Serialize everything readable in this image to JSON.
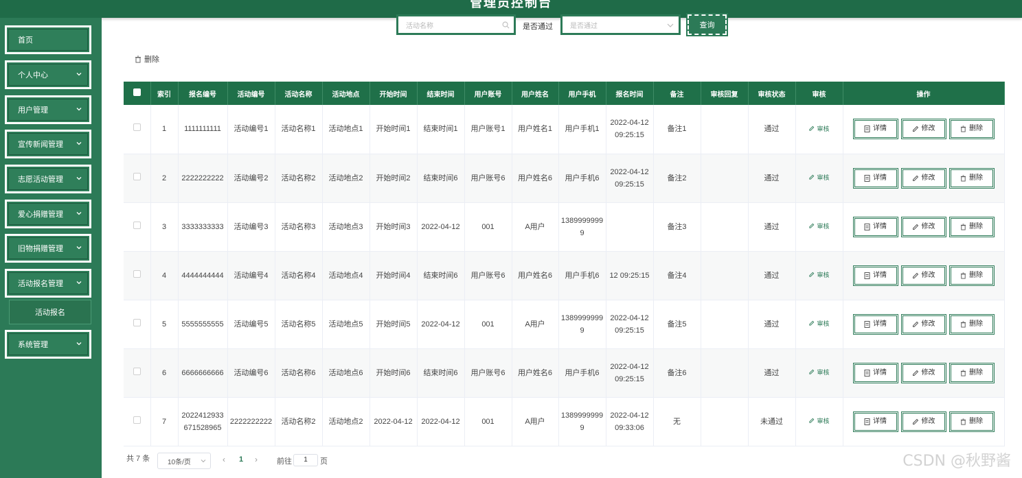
{
  "header": {
    "title": "管理员控制台"
  },
  "sidebar": {
    "items": [
      {
        "label": "首页",
        "has_chevron": false
      },
      {
        "label": "个人中心",
        "has_chevron": true
      },
      {
        "label": "用户管理",
        "has_chevron": true
      },
      {
        "label": "宣传新闻管理",
        "has_chevron": true
      },
      {
        "label": "志愿活动管理",
        "has_chevron": true
      },
      {
        "label": "爱心捐赠管理",
        "has_chevron": true
      },
      {
        "label": "旧物捐赠管理",
        "has_chevron": true
      },
      {
        "label": "活动报名管理",
        "has_chevron": true
      },
      {
        "label": "系统管理",
        "has_chevron": true
      }
    ],
    "submenu": {
      "label": "活动报名"
    }
  },
  "search": {
    "name_placeholder": "活动名称",
    "pass_label": "是否通过",
    "pass_placeholder": "是否通过",
    "query_button": "查询"
  },
  "toolbar": {
    "delete_label": "删除"
  },
  "table": {
    "columns": [
      "索引",
      "报名编号",
      "活动编号",
      "活动名称",
      "活动地点",
      "开始时间",
      "结束时间",
      "用户账号",
      "用户姓名",
      "用户手机",
      "报名时间",
      "备注",
      "审核回复",
      "审核状态",
      "审核",
      "操作"
    ],
    "rows": [
      {
        "index": "1",
        "reg_no": "1111111111",
        "act_no": "活动编号1",
        "act_name": "活动名称1",
        "location": "活动地点1",
        "start": "开始时间1",
        "end": "结束时间1",
        "account": "用户账号1",
        "name": "用户姓名1",
        "phone": "用户手机1",
        "reg_time": "2022-04-12 09:25:15",
        "remark": "备注1",
        "reply": "",
        "status": "通过"
      },
      {
        "index": "2",
        "reg_no": "2222222222",
        "act_no": "活动编号2",
        "act_name": "活动名称2",
        "location": "活动地点2",
        "start": "开始时间2",
        "end": "结束时间6",
        "account": "用户账号6",
        "name": "用户姓名6",
        "phone": "用户手机6",
        "reg_time": "2022-04-12 09:25:15",
        "remark": "备注2",
        "reply": "",
        "status": "通过"
      },
      {
        "index": "3",
        "reg_no": "3333333333",
        "act_no": "活动编号3",
        "act_name": "活动名称3",
        "location": "活动地点3",
        "start": "开始时间3",
        "end": "2022-04-12",
        "account": "001",
        "name": "A用户",
        "phone": "13899999999",
        "reg_time": "",
        "remark": "备注3",
        "reply": "",
        "status": "通过"
      },
      {
        "index": "4",
        "reg_no": "4444444444",
        "act_no": "活动编号4",
        "act_name": "活动名称4",
        "location": "活动地点4",
        "start": "开始时间4",
        "end": "结束时间6",
        "account": "用户账号6",
        "name": "用户姓名6",
        "phone": "用户手机6",
        "reg_time": "12 09:25:15",
        "remark": "备注4",
        "reply": "",
        "status": "通过"
      },
      {
        "index": "5",
        "reg_no": "5555555555",
        "act_no": "活动编号5",
        "act_name": "活动名称5",
        "location": "活动地点5",
        "start": "开始时间5",
        "end": "2022-04-12",
        "account": "001",
        "name": "A用户",
        "phone": "13899999999",
        "reg_time": "2022-04-12 09:25:15",
        "remark": "备注5",
        "reply": "",
        "status": "通过"
      },
      {
        "index": "6",
        "reg_no": "6666666666",
        "act_no": "活动编号6",
        "act_name": "活动名称6",
        "location": "活动地点6",
        "start": "开始时间6",
        "end": "结束时间6",
        "account": "用户账号6",
        "name": "用户姓名6",
        "phone": "用户手机6",
        "reg_time": "2022-04-12 09:25:15",
        "remark": "备注6",
        "reply": "",
        "status": "通过"
      },
      {
        "index": "7",
        "reg_no": "2022412933671528965",
        "act_no": "2222222222",
        "act_name": "活动名称2",
        "location": "活动地点2",
        "start": "2022-04-12",
        "end": "2022-04-12",
        "account": "001",
        "name": "A用户",
        "phone": "13899999999",
        "reg_time": "2022-04-12 09:33:06",
        "remark": "无",
        "reply": "",
        "status": "未通过"
      }
    ],
    "audit_label": "审核",
    "detail_label": "详情",
    "edit_label": "修改",
    "delete_label": "删除"
  },
  "pagination": {
    "total": "共 7 条",
    "page_size": "10条/页",
    "current": "1",
    "goto_prefix": "前往",
    "goto_value": "1",
    "goto_suffix": "页"
  },
  "watermark": "CSDN @秋野酱",
  "colors": {
    "primary": "#2c7a57",
    "header": "#1f7049"
  }
}
